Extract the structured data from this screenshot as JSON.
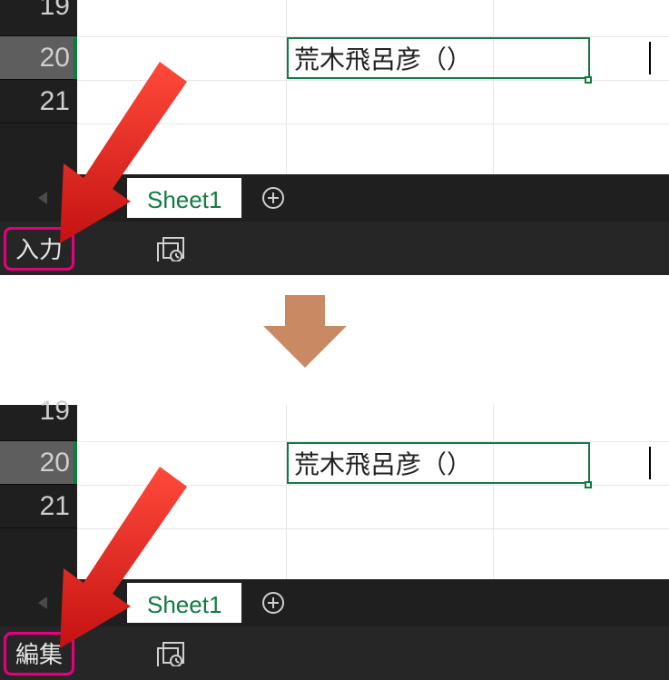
{
  "rows": {
    "r19": "19",
    "r20": "20",
    "r21": "21"
  },
  "cell_value": "荒木飛呂彦（）",
  "sheet": {
    "tab_label": "Sheet1"
  },
  "status": {
    "mode_top": "入力",
    "mode_bottom": "編集"
  }
}
